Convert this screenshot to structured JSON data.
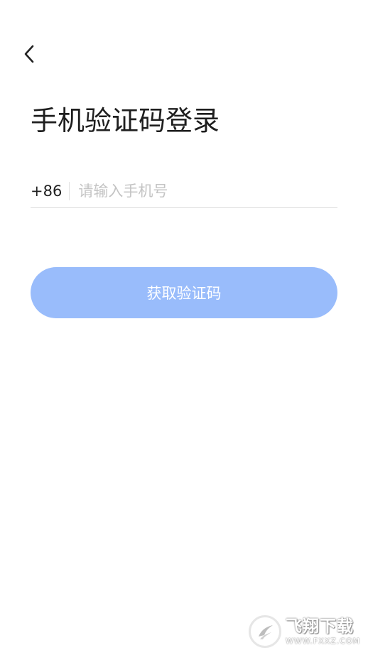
{
  "header": {
    "back_icon": "chevron-left-icon"
  },
  "title": "手机验证码登录",
  "phone": {
    "country_code": "+86",
    "value": "",
    "placeholder": "请输入手机号"
  },
  "actions": {
    "get_code_label": "获取验证码"
  },
  "watermark": {
    "name": "飞翔下载",
    "url": "WWW.FXXZ.COM"
  },
  "colors": {
    "button_bg": "#99bcfb",
    "button_text": "#ffffff",
    "title_text": "#1e1e1e",
    "placeholder": "#c4c4c4",
    "underline": "#dcdcdc"
  }
}
